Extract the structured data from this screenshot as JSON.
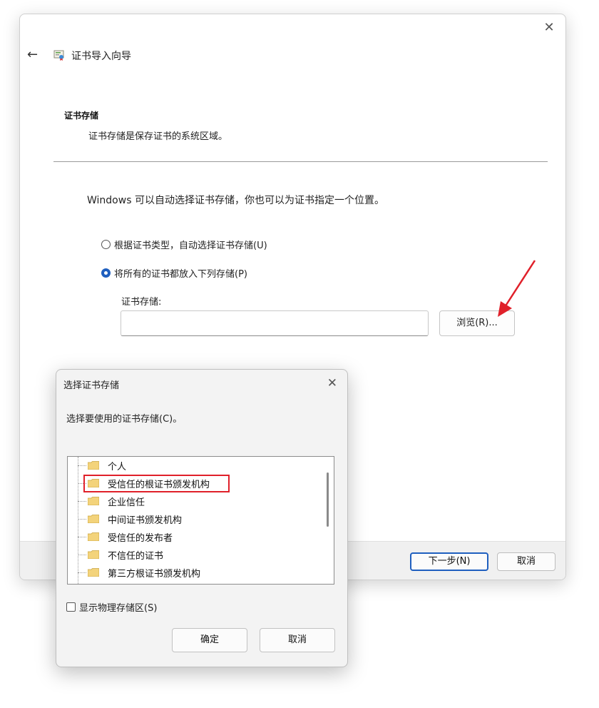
{
  "wizard": {
    "title": "证书导入向导",
    "section_title": "证书存储",
    "section_desc": "证书存储是保存证书的系统区域。",
    "intro": "Windows 可以自动选择证书存储，你也可以为证书指定一个位置。",
    "radio_auto": "根据证书类型，自动选择证书存储(U)",
    "radio_manual": "将所有的证书都放入下列存储(P)",
    "store_label": "证书存储:",
    "store_value": "",
    "browse_label": "浏览(R)...",
    "next_label": "下一步(N)",
    "cancel_label": "取消"
  },
  "dialog": {
    "title": "选择证书存储",
    "prompt": "选择要使用的证书存储(C)。",
    "stores": [
      "个人",
      "受信任的根证书颁发机构",
      "企业信任",
      "中间证书颁发机构",
      "受信任的发布者",
      "不信任的证书",
      "第三方根证书颁发机构"
    ],
    "show_physical": "显示物理存储区(S)",
    "ok_label": "确定",
    "cancel_label": "取消"
  },
  "colors": {
    "accent": "#1f5fbf",
    "annotation": "#e0202a",
    "folder": "#f3d37b"
  }
}
